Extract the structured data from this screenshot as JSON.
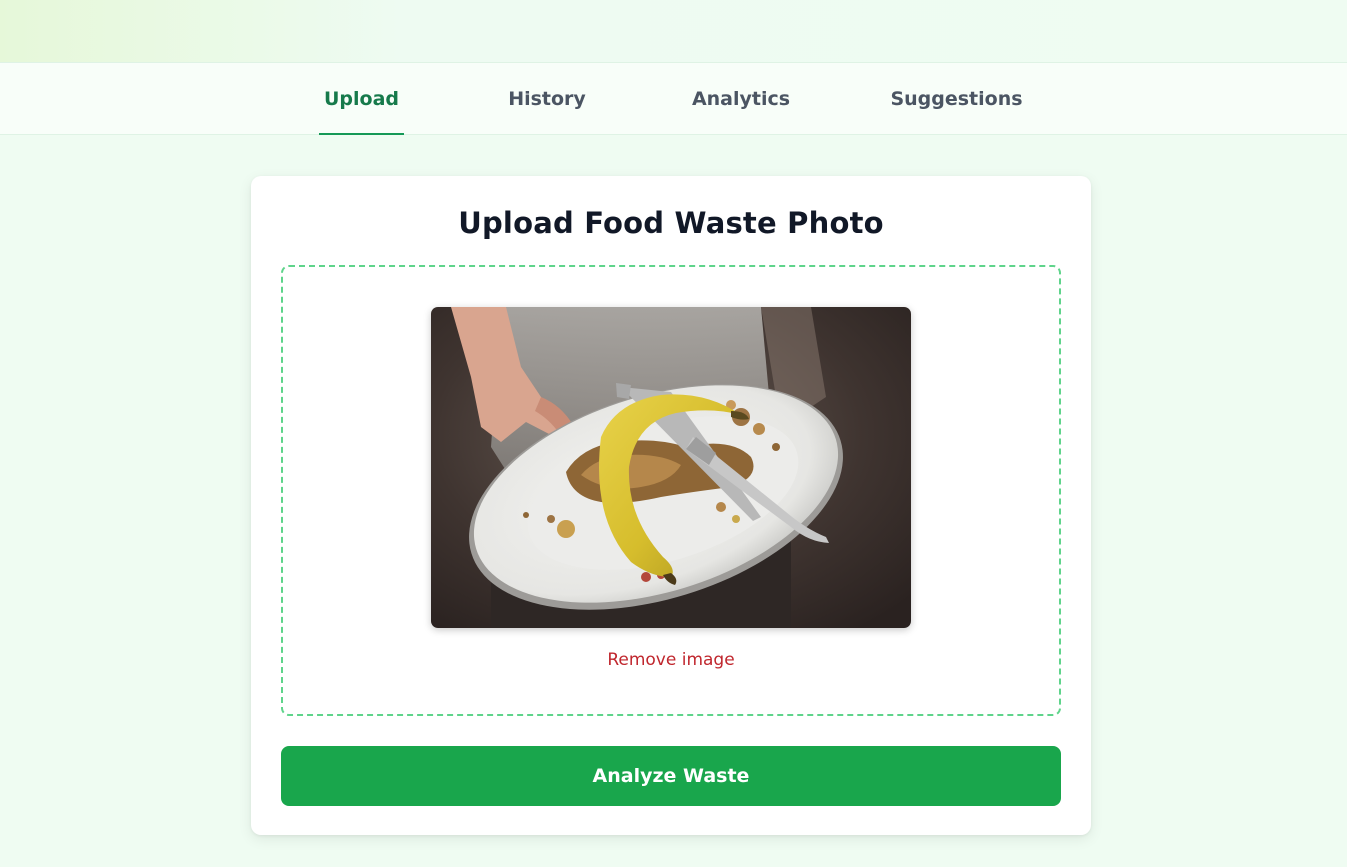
{
  "tabs": [
    {
      "label": "Upload",
      "active": true
    },
    {
      "label": "History",
      "active": false
    },
    {
      "label": "Analytics",
      "active": false
    },
    {
      "label": "Suggestions",
      "active": false
    }
  ],
  "upload_card": {
    "title": "Upload Food Waste Photo",
    "remove_label": "Remove image",
    "analyze_label": "Analyze Waste"
  },
  "colors": {
    "accent": "#19a64c",
    "active_tab": "#167a4b",
    "dropzone_border": "#5fd48b",
    "remove": "#c0262d",
    "page_background": "#effcf2"
  }
}
